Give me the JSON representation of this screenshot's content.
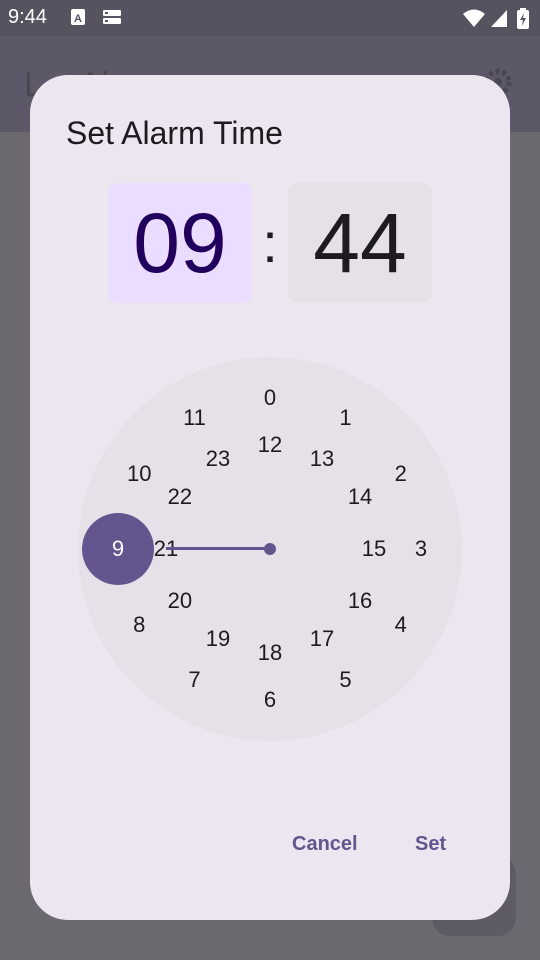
{
  "status_bar": {
    "time": "9:44"
  },
  "background_app": {
    "title": "L... Al..."
  },
  "dialog": {
    "title": "Set Alarm Time",
    "hour": "09",
    "separator": ":",
    "minute": "44",
    "selected_value": "9",
    "outer_numbers": [
      "0",
      "1",
      "2",
      "3",
      "4",
      "5",
      "6",
      "7",
      "8",
      "9",
      "10",
      "11"
    ],
    "inner_numbers": [
      "12",
      "13",
      "14",
      "15",
      "16",
      "17",
      "18",
      "19",
      "20",
      "21",
      "22",
      "23"
    ],
    "cancel_label": "Cancel",
    "set_label": "Set"
  },
  "colors": {
    "accent": "#65558f",
    "dialog_bg": "#ece6f0",
    "clock_face": "#e6e0e9",
    "hour_selected_bg": "#eaddff"
  }
}
